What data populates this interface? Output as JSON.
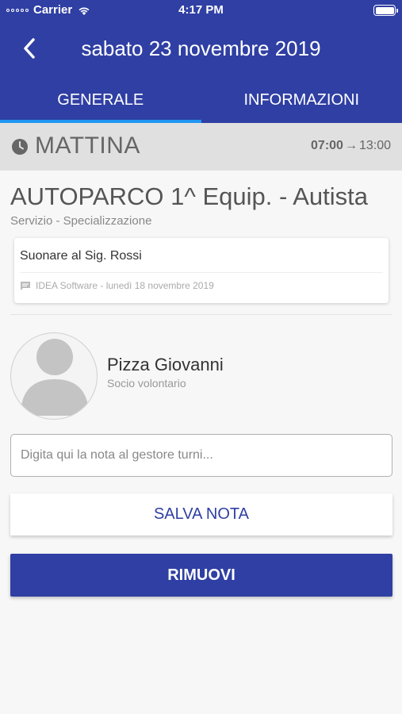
{
  "status_bar": {
    "carrier": "Carrier",
    "time": "4:17 PM"
  },
  "header": {
    "back_icon": "chevron-left-icon",
    "title": "sabato 23 novembre 2019"
  },
  "tabs": [
    {
      "label": "GENERALE",
      "active": true
    },
    {
      "label": "INFORMAZIONI",
      "active": false
    }
  ],
  "shift": {
    "icon": "clock-icon",
    "name": "MATTINA",
    "start": "07:00",
    "arrow": "→",
    "end": "13:00"
  },
  "service": {
    "title": "AUTOPARCO 1^ Equip. - Autista",
    "subtitle": "Servizio - Specializzazione"
  },
  "note": {
    "text": "Suonare al Sig. Rossi",
    "meta_icon": "message-icon",
    "meta": "IDEA Software - lunedì 18 novembre 2019"
  },
  "person": {
    "name": "Pizza Giovanni",
    "role": "Socio volontario"
  },
  "note_input": {
    "value": "",
    "placeholder": "Digita qui la nota al gestore turni..."
  },
  "actions": {
    "save_label": "SALVA NOTA",
    "remove_label": "RIMUOVI"
  },
  "colors": {
    "primary": "#2f3fa3",
    "tab_indicator": "#2196f3",
    "shift_bar": "#e0e0e0"
  }
}
